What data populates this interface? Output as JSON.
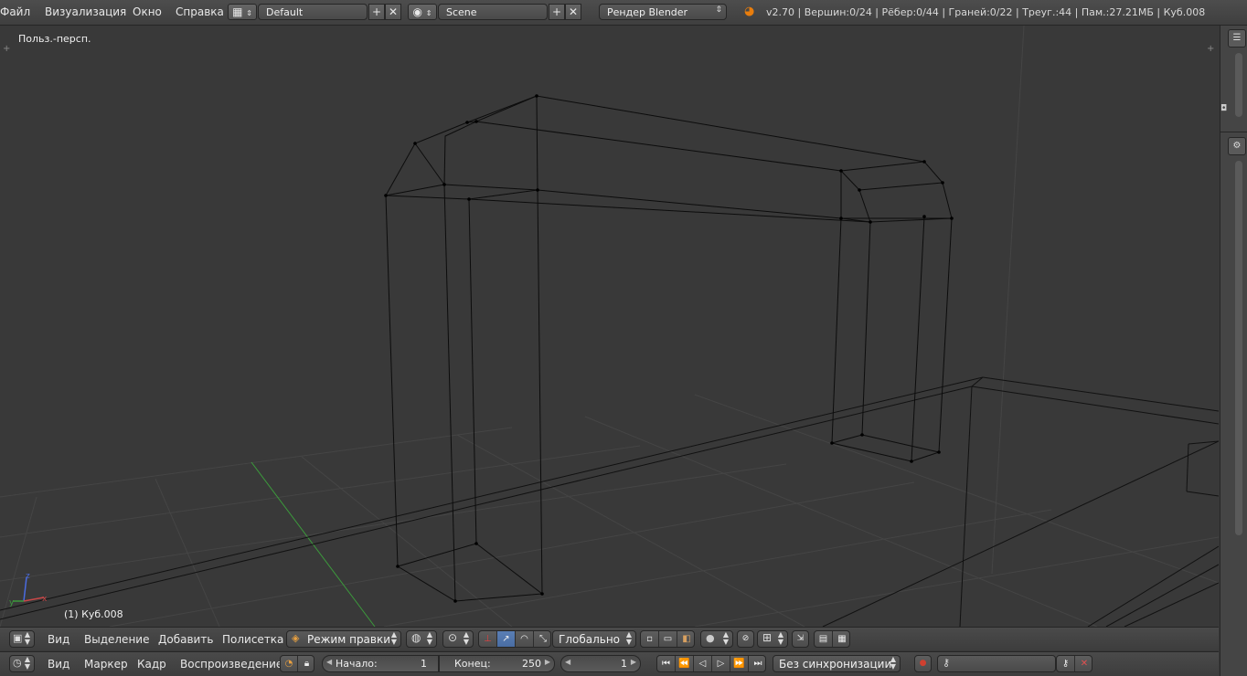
{
  "topbar": {
    "menus": [
      "Файл",
      "Визуализация",
      "Окно",
      "Справка"
    ],
    "layout_name": "Default",
    "scene_name": "Scene",
    "render_engine": "Рендер Blender",
    "stats": "v2.70 | Вершин:0/24 | Рёбер:0/44 | Граней:0/22 | Треуг.:44 | Пам.:27.21МБ | Куб.008",
    "add_icon": "plus-icon",
    "remove_icon": "close-icon"
  },
  "viewport": {
    "view_name": "Польз.-персп.",
    "object_label": "(1) Куб.008",
    "background_color": "#393939",
    "grid_color": "#4a4a4a",
    "x_axis_color": "#c84848",
    "y_axis_color": "#3c9a3c",
    "axis_labels": {
      "z": "z",
      "y": "y",
      "x": "x"
    }
  },
  "view3d_header": {
    "menus": [
      "Вид",
      "Выделение",
      "Добавить",
      "Полисетка"
    ],
    "mode": "Режим правки",
    "orientation": "Глобально",
    "icons": [
      "view3d-editor-icon",
      "viewport-shading-icon",
      "pivot-icon",
      "manipulator-icon",
      "translate-icon",
      "rotate-icon",
      "scale-icon",
      "vertex-select-icon",
      "edge-select-icon",
      "face-select-icon",
      "occlude-icon",
      "proportional-edit-icon",
      "snap-icon",
      "snap-target-icon",
      "render-icon",
      "glsl-icon"
    ]
  },
  "timeline_header": {
    "menus": [
      "Вид",
      "Маркер",
      "Кадр",
      "Воспроизведение"
    ],
    "start_label": "Начало:",
    "start_value": "1",
    "end_label": "Конец:",
    "end_value": "250",
    "current_frame": "1",
    "sync": "Без синхронизации",
    "playback_icons": [
      "jump-start-icon",
      "jump-keyframe-prev-icon",
      "play-reverse-icon",
      "play-icon",
      "jump-keyframe-next-icon",
      "jump-end-icon"
    ]
  },
  "colors": {
    "selected": "#5a7fb5",
    "header": "#4a4a4a",
    "record": "#d04030"
  }
}
